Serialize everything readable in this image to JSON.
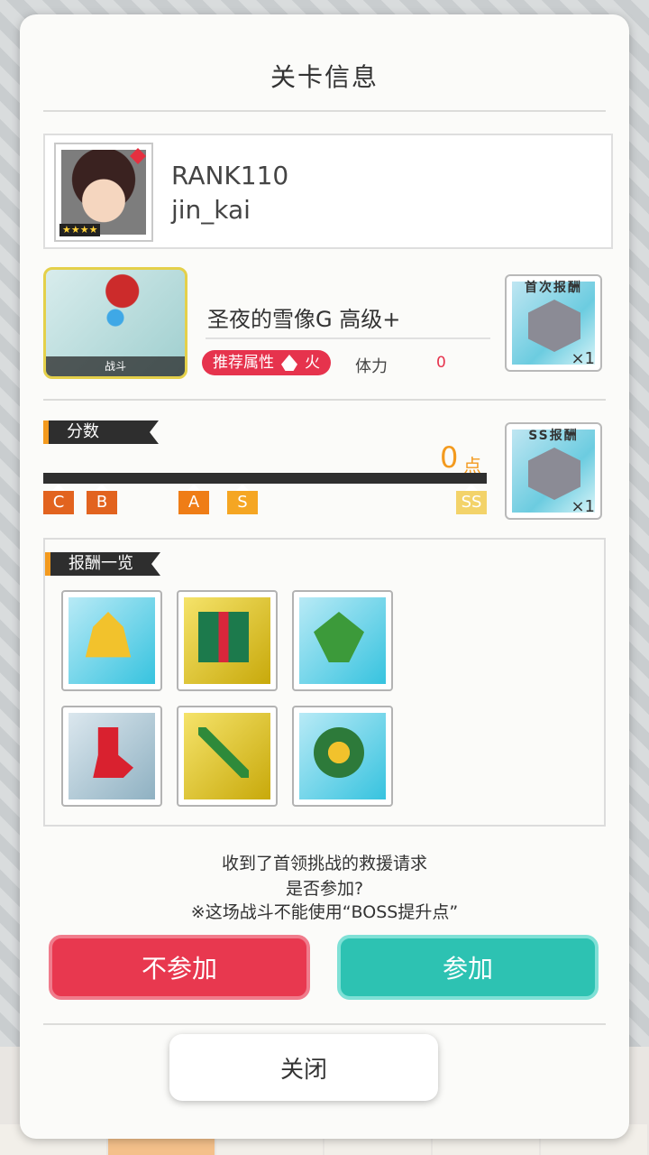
{
  "dialog": {
    "title": "关卡信息"
  },
  "player": {
    "rank": "RANK110",
    "name": "jin_kai",
    "stars": "★★★★"
  },
  "stage": {
    "image_label": "战斗",
    "name": "圣夜的雪像G 高级+",
    "recommend_label": "推荐属性",
    "recommend_element": "火",
    "stamina_label": "体力",
    "stamina_value": "0"
  },
  "first_reward": {
    "label": "首次报酬",
    "qty": "×1",
    "icon": "silver-gem-icon"
  },
  "ss_reward": {
    "label": "SS报酬",
    "qty": "×1",
    "icon": "silver-gem-icon"
  },
  "score": {
    "tag": "分数",
    "value": "0",
    "unit": "点",
    "progress": 0,
    "marks": [
      {
        "label": "C",
        "color": "#e2631f"
      },
      {
        "label": "B",
        "color": "#e2631f"
      },
      {
        "label": "A",
        "color": "#ef7d16"
      },
      {
        "label": "S",
        "color": "#f5a623"
      },
      {
        "label": "SS",
        "color": "#f3d36a"
      }
    ]
  },
  "rewards_list": {
    "tag": "报酬一览",
    "items": [
      {
        "icon": "bell-icon"
      },
      {
        "icon": "gift-box-icon"
      },
      {
        "icon": "holly-candy-cane-icon"
      },
      {
        "icon": "stocking-icon"
      },
      {
        "icon": "sword-icon"
      },
      {
        "icon": "wreath-icon"
      }
    ]
  },
  "message": {
    "line1": "收到了首领挑战的救援请求",
    "line2": "是否参加?",
    "line3": "※这场战斗不能使用“BOSS提升点”"
  },
  "buttons": {
    "decline": "不参加",
    "join": "参加",
    "close": "关闭"
  }
}
